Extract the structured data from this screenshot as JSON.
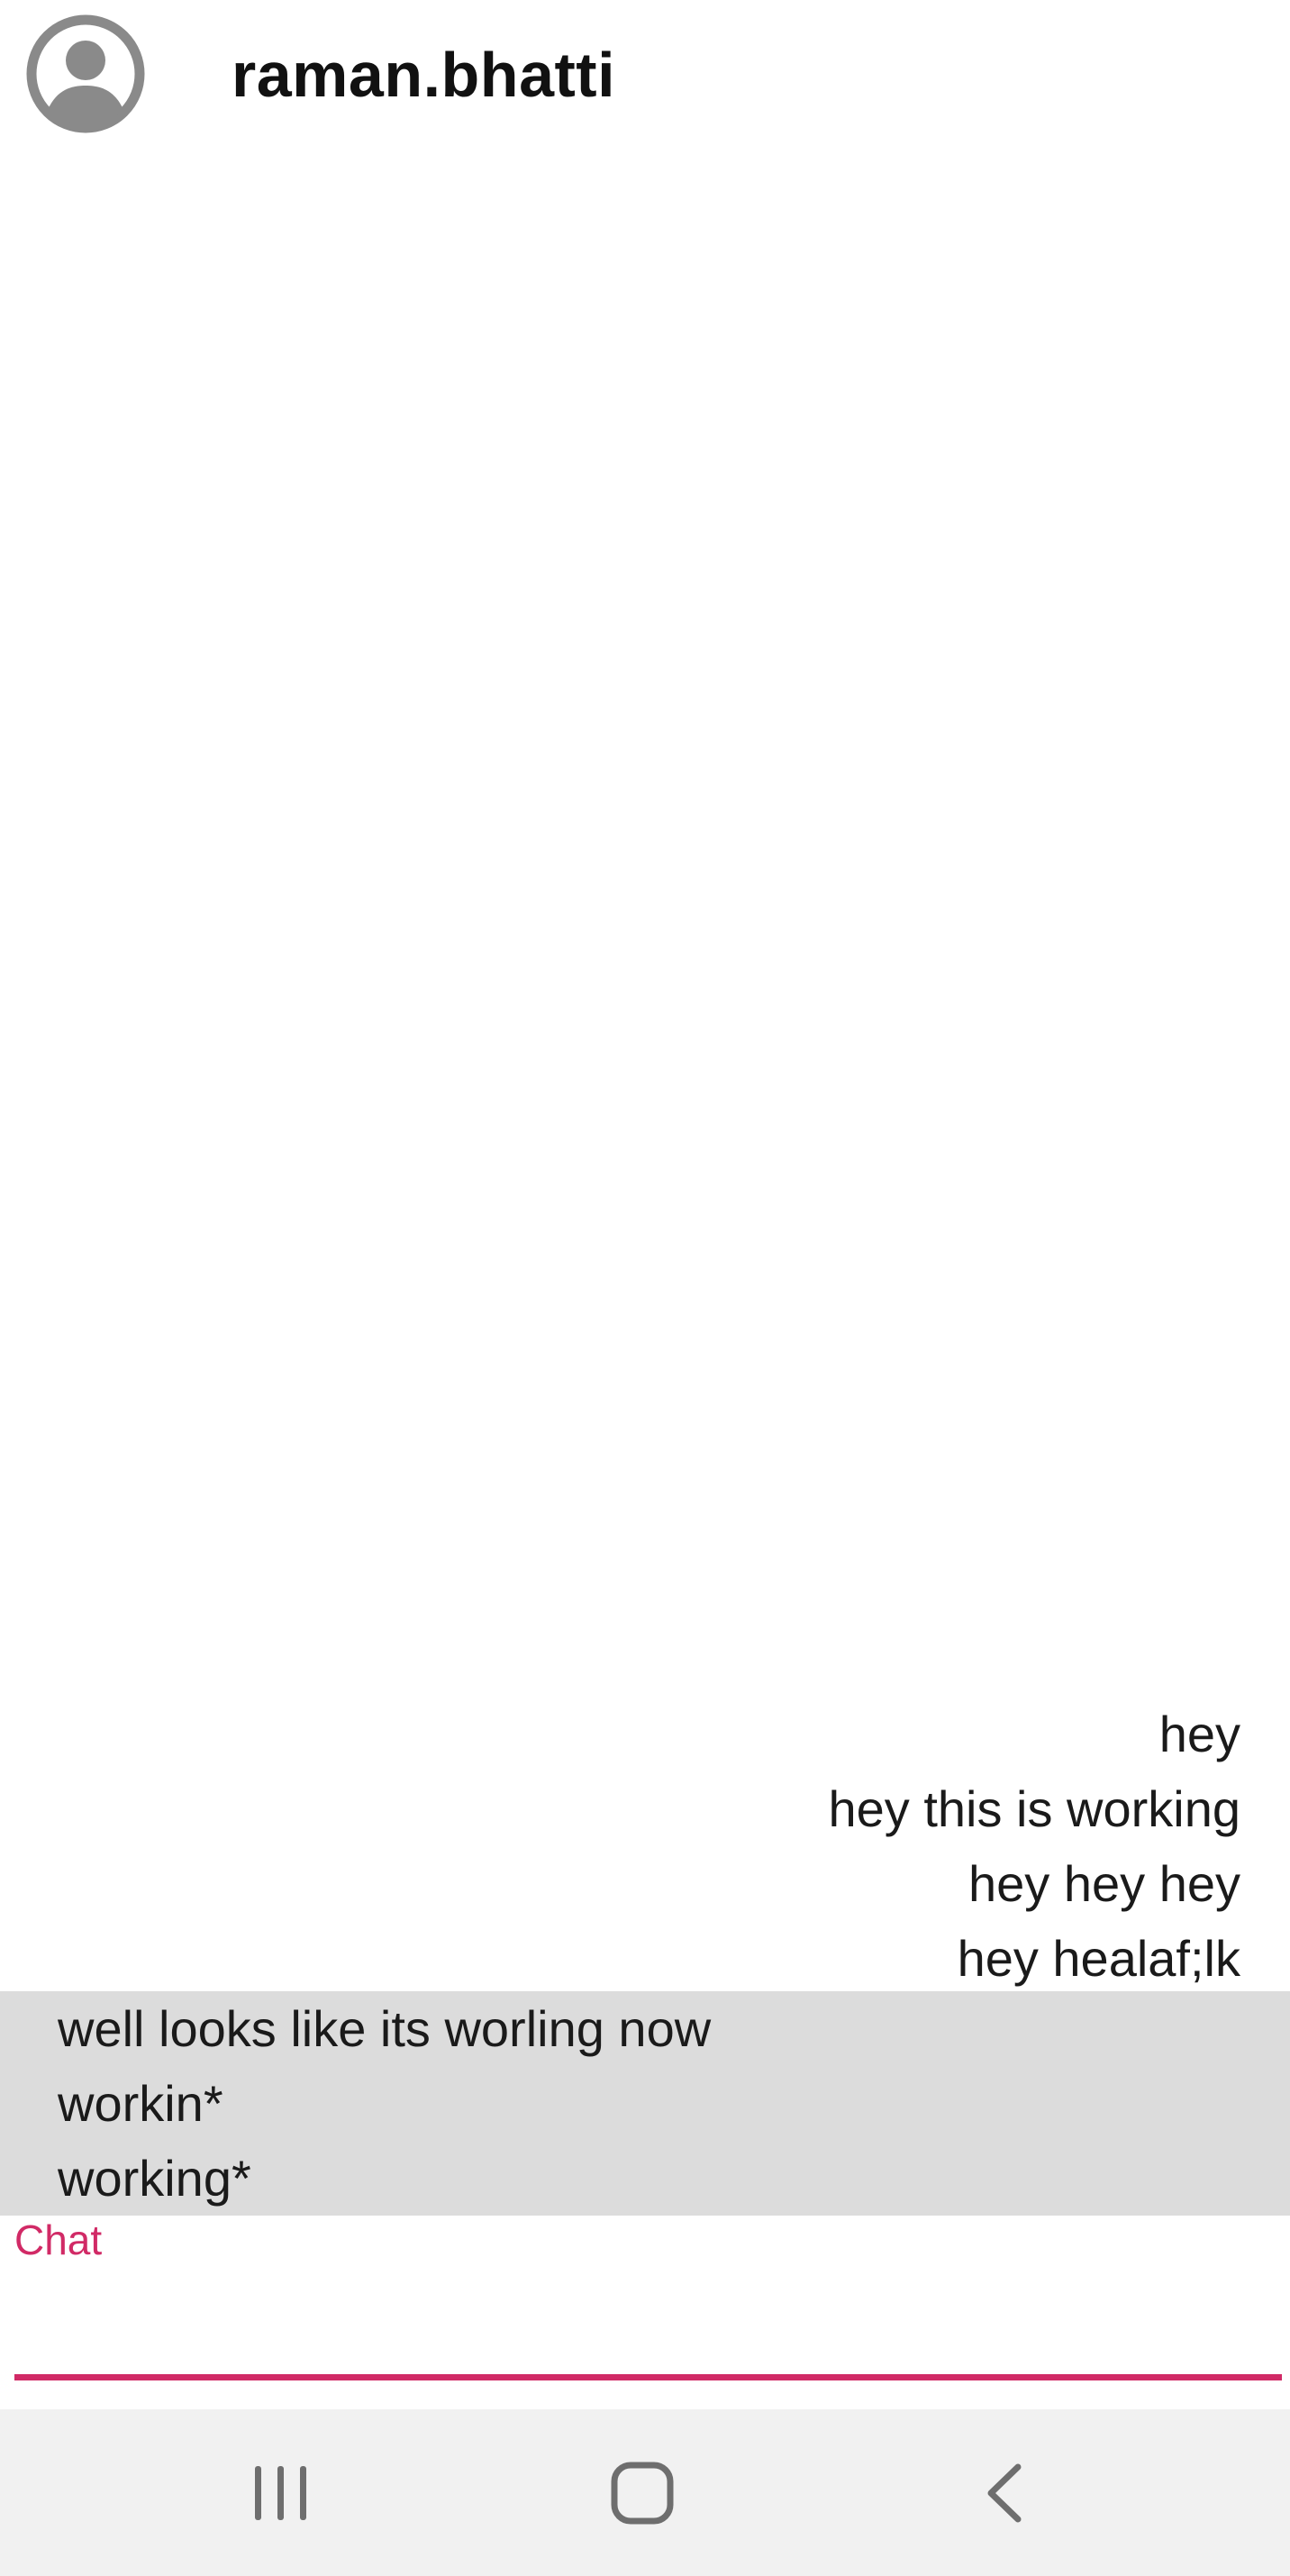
{
  "header": {
    "username": "raman.bhatti",
    "avatar_icon": "account-circle-icon"
  },
  "messages": {
    "sent": [
      "hey",
      "hey this is working",
      "hey hey hey",
      "hey healaf;lk"
    ],
    "received": [
      "well looks like its worling now",
      "workin*",
      "working*"
    ]
  },
  "composer": {
    "label": "Chat",
    "value": "",
    "accent_color": "#d12a66"
  },
  "navbar": {
    "recents_icon": "recent-apps-icon",
    "home_icon": "home-icon",
    "back_icon": "back-icon"
  },
  "colors": {
    "received_bg": "#dcdcdc",
    "navbar_bg": "#f1f1f1",
    "avatar": "#8a8a8a"
  }
}
